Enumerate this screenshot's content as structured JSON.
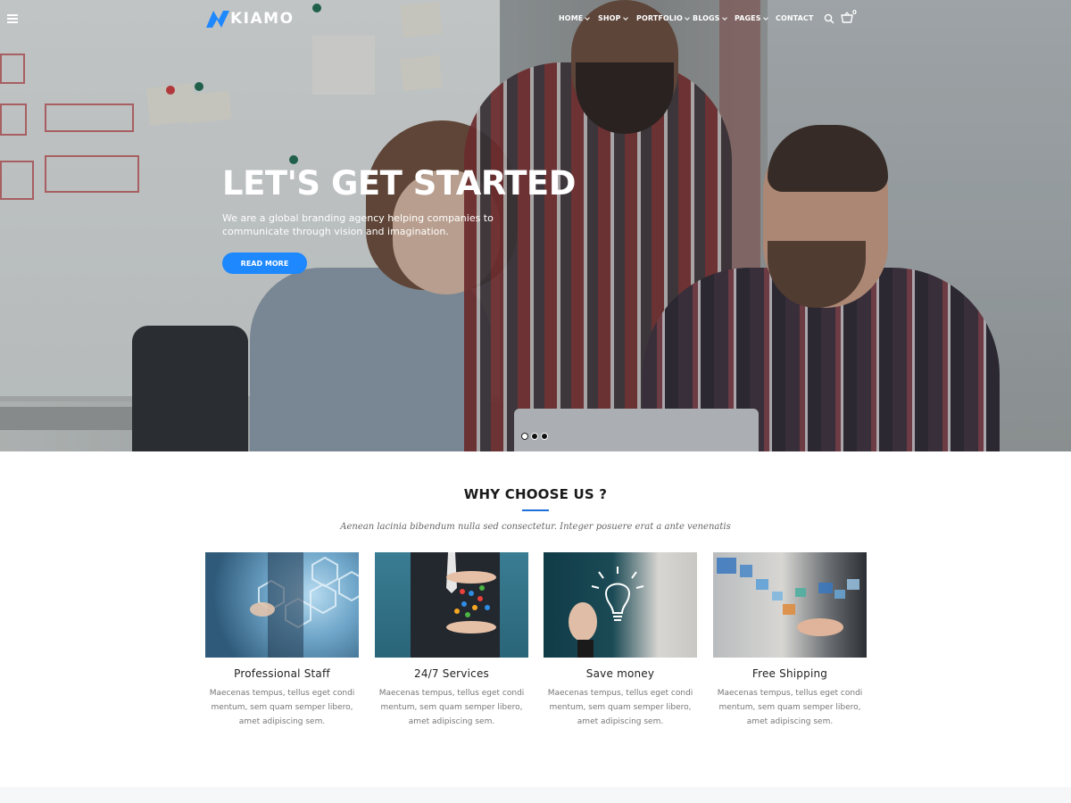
{
  "header": {
    "logo_text": "KIAMO",
    "nav": [
      {
        "label": "HOME",
        "has_dropdown": true
      },
      {
        "label": "SHOP",
        "has_dropdown": true
      },
      {
        "label": "PORTFOLIO",
        "has_dropdown": true
      },
      {
        "label": "BLOGS",
        "has_dropdown": true
      },
      {
        "label": "PAGES",
        "has_dropdown": true
      },
      {
        "label": "CONTACT",
        "has_dropdown": false
      }
    ],
    "cart_count": "0",
    "icons": [
      "hamburger-icon",
      "search-icon",
      "cart-icon"
    ]
  },
  "hero": {
    "title": "LET'S GET STARTED",
    "text": "We are a global branding agency helping companies to communicate through vision and imagination.",
    "button_label": "READ MORE",
    "slides": 3,
    "active_slide": 1
  },
  "why_choose": {
    "title": "WHY CHOOSE US ?",
    "subtitle": "Aenean lacinia bibendum nulla sed consectetur. Integer posuere erat a ante venenatis",
    "cards": [
      {
        "title": "Professional Staff",
        "text": "Maecenas tempus, tellus eget condi mentum, sem quam semper libero, amet adipiscing sem."
      },
      {
        "title": "24/7 Services",
        "text": "Maecenas tempus, tellus eget condi mentum, sem quam semper libero, amet adipiscing sem."
      },
      {
        "title": "Save money",
        "text": "Maecenas tempus, tellus eget condi mentum, sem quam semper libero, amet adipiscing sem."
      },
      {
        "title": "Free Shipping",
        "text": "Maecenas tempus, tellus eget condi mentum, sem quam semper libero, amet adipiscing sem."
      }
    ]
  },
  "colors": {
    "accent": "#1e88ff",
    "section_line": "#1e6fd9",
    "text_dark": "#222222",
    "text_muted": "#777777"
  }
}
